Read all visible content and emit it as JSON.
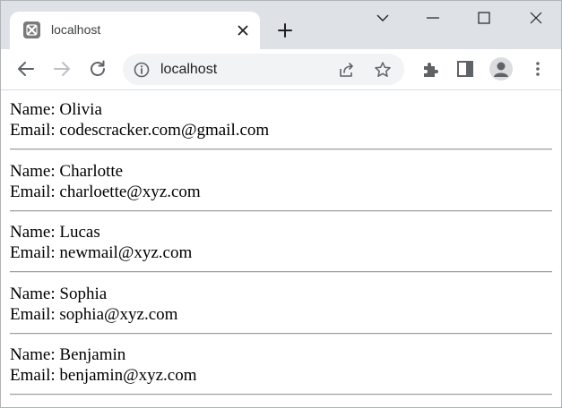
{
  "browser": {
    "tab_title": "localhost",
    "url": "localhost"
  },
  "records": [
    {
      "name_line": "Name: Olivia",
      "email_line": "Email: codescracker.com@gmail.com"
    },
    {
      "name_line": "Name: Charlotte",
      "email_line": "Email: charloette@xyz.com"
    },
    {
      "name_line": "Name: Lucas",
      "email_line": "Email: newmail@xyz.com"
    },
    {
      "name_line": "Name: Sophia",
      "email_line": "Email: sophia@xyz.com"
    },
    {
      "name_line": "Name: Benjamin",
      "email_line": "Email: benjamin@xyz.com"
    }
  ],
  "colors": {
    "tabstrip_bg": "#dee1e6",
    "omnibox_bg": "#f1f3f4",
    "icon_gray": "#5f6368"
  },
  "icons": [
    "xampp-favicon-icon",
    "close-icon",
    "plus-icon",
    "chevron-down-icon",
    "minimize-icon",
    "maximize-icon",
    "window-close-icon",
    "back-arrow-icon",
    "forward-arrow-icon",
    "reload-icon",
    "info-icon",
    "share-icon",
    "star-icon",
    "extensions-icon",
    "side-panel-icon",
    "profile-icon",
    "kebab-menu-icon"
  ]
}
